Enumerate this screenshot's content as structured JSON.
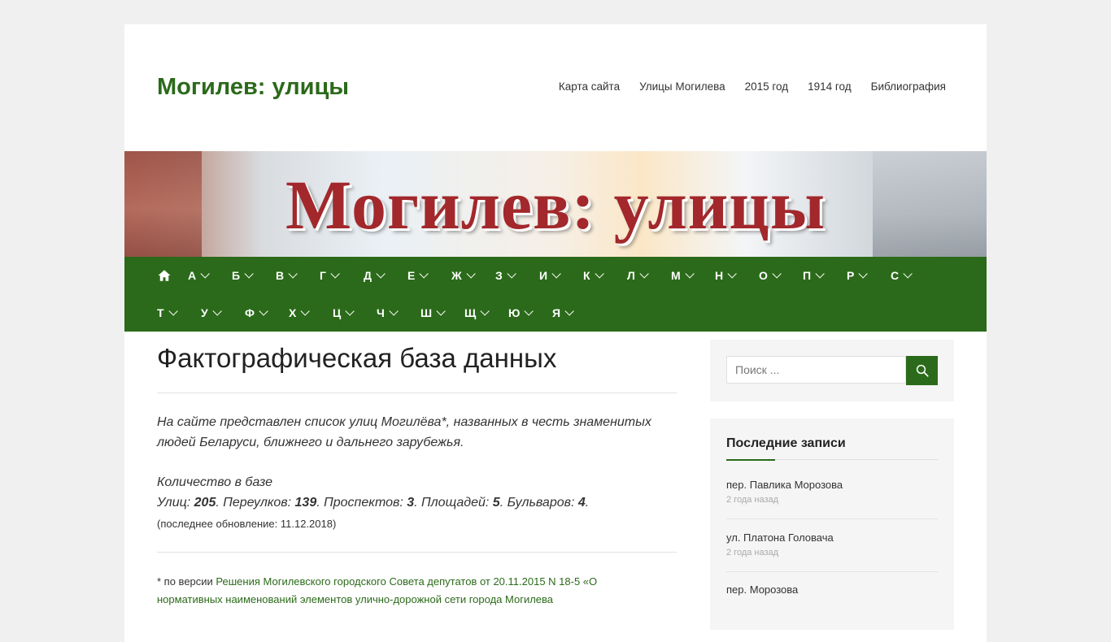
{
  "site": {
    "title": "Могилев: улицы"
  },
  "top_nav": [
    "Карта сайта",
    "Улицы Могилева",
    "2015 год",
    "1914 год",
    "Библиография"
  ],
  "banner": {
    "text": "Могилев: улицы"
  },
  "alphabet_row1": [
    "А",
    "Б",
    "В",
    "Г",
    "Д",
    "Е",
    "Ж",
    "З",
    "И",
    "К",
    "Л",
    "М",
    "Н",
    "О",
    "П",
    "Р",
    "С"
  ],
  "alphabet_row2": [
    "Т",
    "У",
    "Ф",
    "Х",
    "Ц",
    "Ч",
    "Ш",
    "Щ",
    "Ю",
    "Я"
  ],
  "main": {
    "title": "Фактографическая база данных",
    "intro": "На сайте представлен список улиц Могилёва*, названных в честь знаменитых людей Беларуси, ближнего и дальнего зарубежья.",
    "count_heading": "Количество в базе",
    "streets_label": "Улиц: ",
    "streets": "205",
    "lanes_label": ". Переулков: ",
    "lanes": "139",
    "avenues_label": ". Проспектов: ",
    "avenues": "3",
    "squares_label": ". Площадей: ",
    "squares": "5",
    "boulevards_label": ". Бульваров: ",
    "boulevards": "4",
    "end_dot": ".",
    "updated": "(последнее обновление: 11.12.2018)",
    "footnote_prefix": "* по версии ",
    "footnote_link": "Решения Могилевского городского Совета депутатов от 20.11.2015 N 18-5 «О",
    "footnote_line2": "нормативных наименований элементов улично-дорожной сети города Могилева"
  },
  "sidebar": {
    "search_placeholder": "Поиск ...",
    "recent_title": "Последние записи",
    "recent": [
      {
        "title": "пер. Павлика Морозова",
        "date": "2 года назад"
      },
      {
        "title": "ул. Платона Головача",
        "date": "2 года назад"
      },
      {
        "title": "пер. Морозова",
        "date": ""
      }
    ]
  },
  "colors": {
    "brand_green": "#2b6a1a",
    "banner_red": "#a2282c"
  }
}
